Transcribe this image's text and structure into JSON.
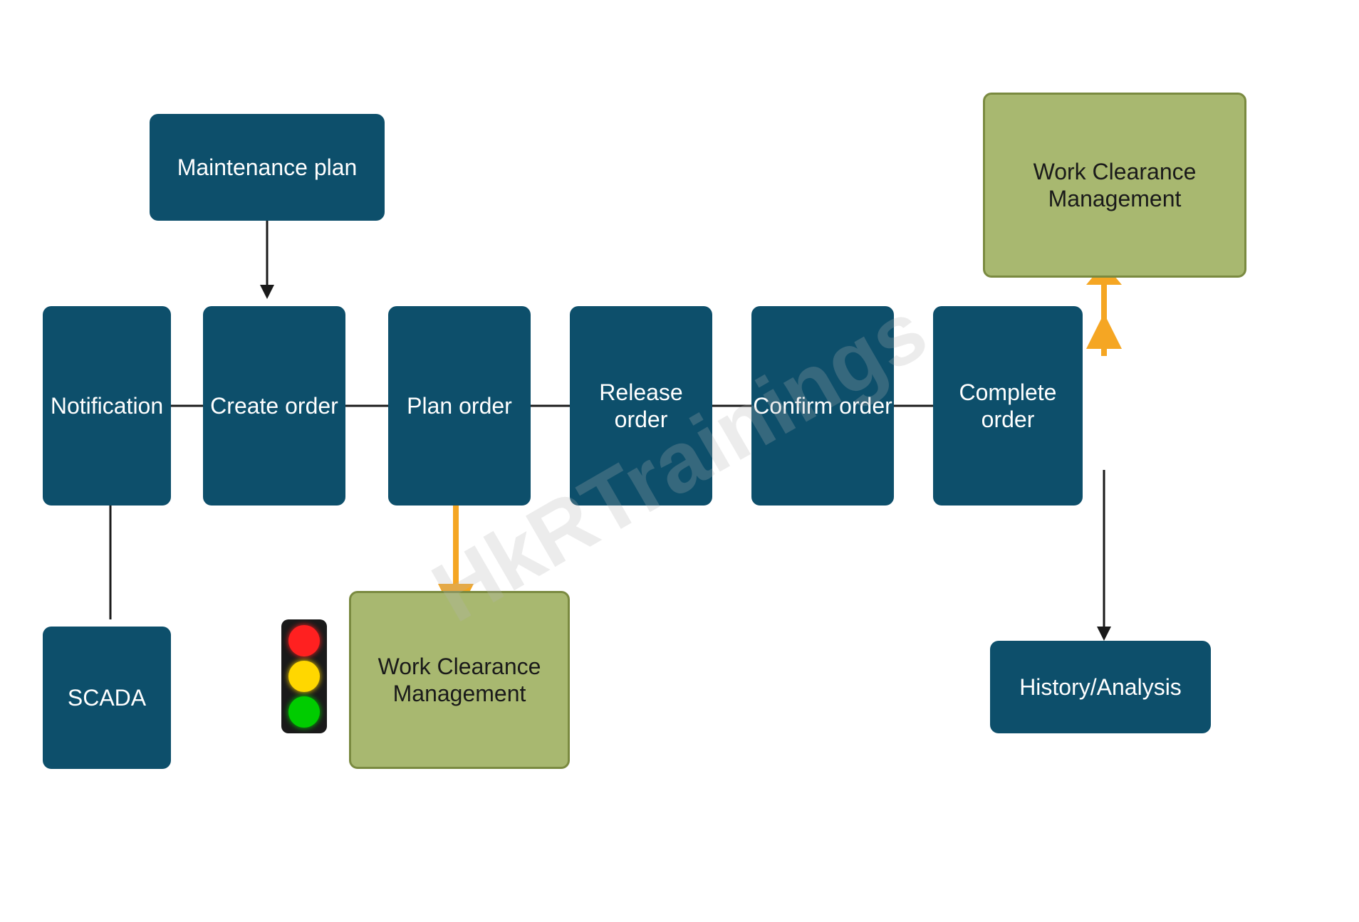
{
  "watermark": "HkRTrainings",
  "boxes": {
    "maintenance_plan": {
      "label": "Maintenance plan"
    },
    "notification": {
      "label": "Notification"
    },
    "create_order": {
      "label": "Create order"
    },
    "plan_order": {
      "label": "Plan order"
    },
    "release_order": {
      "label": "Release order"
    },
    "confirm_order": {
      "label": "Confirm order"
    },
    "complete_order": {
      "label": "Complete order"
    },
    "scada": {
      "label": "SCADA"
    },
    "wcm_bottom": {
      "label": "Work Clearance Management"
    },
    "wcm_top": {
      "label": "Work Clearance Management"
    },
    "history": {
      "label": "History/Analysis"
    }
  },
  "colors": {
    "dark_teal": "#0d4f6b",
    "green_box": "#a8b870",
    "green_border": "#7a8a40",
    "orange_arrow": "#f5a623",
    "black_arrow": "#1a1a1a",
    "white": "#ffffff"
  }
}
